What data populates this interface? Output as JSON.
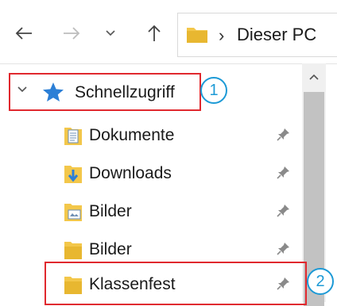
{
  "address": {
    "location": "Dieser PC"
  },
  "tree": {
    "quick_access": {
      "label": "Schnellzugriff"
    },
    "items": [
      {
        "label": "Dokumente",
        "icon": "documents-folder-icon"
      },
      {
        "label": "Downloads",
        "icon": "downloads-folder-icon"
      },
      {
        "label": "Bilder",
        "icon": "pictures-folder-icon"
      },
      {
        "label": "Bilder",
        "icon": "folder-icon"
      },
      {
        "label": "Klassenfest",
        "icon": "folder-icon"
      }
    ]
  },
  "callouts": [
    "1",
    "2"
  ],
  "colors": {
    "highlight": "#e0282e",
    "callout": "#1d9ad6",
    "folder": "#f3c74a",
    "quick_access_star": "#2c7fd6"
  }
}
